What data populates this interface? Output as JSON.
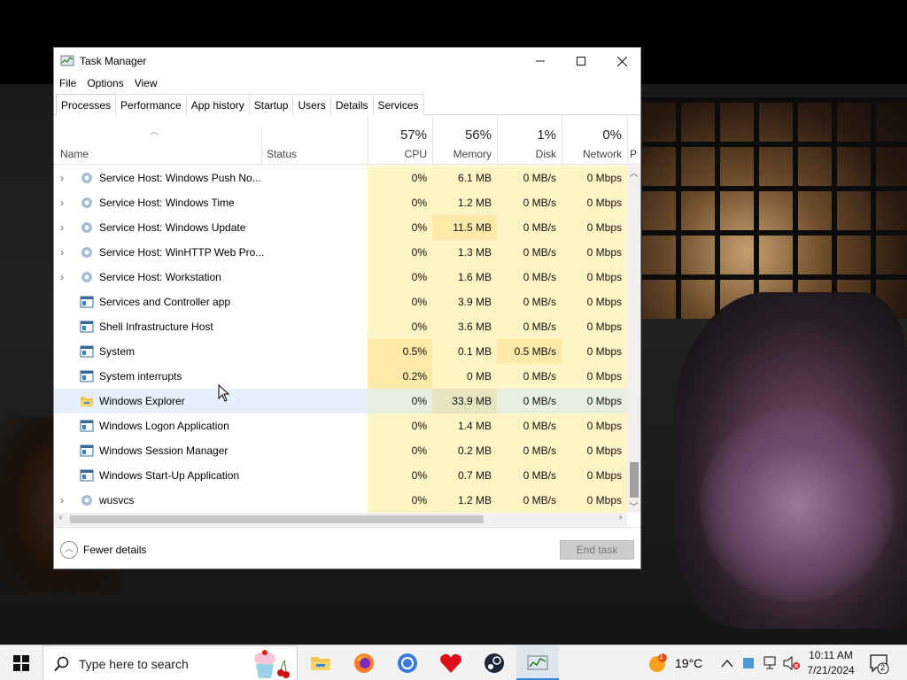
{
  "window": {
    "title": "Task Manager",
    "menu": [
      "File",
      "Options",
      "View"
    ],
    "tabs": [
      "Processes",
      "Performance",
      "App history",
      "Startup",
      "Users",
      "Details",
      "Services"
    ],
    "active_tab": "Processes"
  },
  "columns": {
    "name": "Name",
    "status": "Status",
    "cpu": {
      "pct": "57%",
      "label": "CPU"
    },
    "memory": {
      "pct": "56%",
      "label": "Memory"
    },
    "disk": {
      "pct": "1%",
      "label": "Disk"
    },
    "network": {
      "pct": "0%",
      "label": "Network"
    },
    "power_partial": "P"
  },
  "rows": [
    {
      "name": "Service Host: Windows Push No...",
      "cpu": "0%",
      "mem": "6.1 MB",
      "disk": "0 MB/s",
      "net": "0 Mbps",
      "expandable": true,
      "icon": "gear-icon"
    },
    {
      "name": "Service Host: Windows Time",
      "cpu": "0%",
      "mem": "1.2 MB",
      "disk": "0 MB/s",
      "net": "0 Mbps",
      "expandable": true,
      "icon": "gear-icon"
    },
    {
      "name": "Service Host: Windows Update",
      "cpu": "0%",
      "mem": "11.5 MB",
      "disk": "0 MB/s",
      "net": "0 Mbps",
      "expandable": true,
      "icon": "gear-icon"
    },
    {
      "name": "Service Host: WinHTTP Web Pro...",
      "cpu": "0%",
      "mem": "1.3 MB",
      "disk": "0 MB/s",
      "net": "0 Mbps",
      "expandable": true,
      "icon": "gear-icon"
    },
    {
      "name": "Service Host: Workstation",
      "cpu": "0%",
      "mem": "1.6 MB",
      "disk": "0 MB/s",
      "net": "0 Mbps",
      "expandable": true,
      "icon": "gear-icon"
    },
    {
      "name": "Services and Controller app",
      "cpu": "0%",
      "mem": "3.9 MB",
      "disk": "0 MB/s",
      "net": "0 Mbps",
      "expandable": false,
      "icon": "app-window-icon"
    },
    {
      "name": "Shell Infrastructure Host",
      "cpu": "0%",
      "mem": "3.6 MB",
      "disk": "0 MB/s",
      "net": "0 Mbps",
      "expandable": false,
      "icon": "app-window-icon"
    },
    {
      "name": "System",
      "cpu": "0.5%",
      "mem": "0.1 MB",
      "disk": "0.5 MB/s",
      "net": "0 Mbps",
      "expandable": false,
      "icon": "app-window-icon"
    },
    {
      "name": "System interrupts",
      "cpu": "0.2%",
      "mem": "0 MB",
      "disk": "0 MB/s",
      "net": "0 Mbps",
      "expandable": false,
      "icon": "app-window-icon"
    },
    {
      "name": "Windows Explorer",
      "cpu": "0%",
      "mem": "33.9 MB",
      "disk": "0 MB/s",
      "net": "0 Mbps",
      "expandable": false,
      "icon": "folder-icon"
    },
    {
      "name": "Windows Logon Application",
      "cpu": "0%",
      "mem": "1.4 MB",
      "disk": "0 MB/s",
      "net": "0 Mbps",
      "expandable": false,
      "icon": "app-window-icon"
    },
    {
      "name": "Windows Session Manager",
      "cpu": "0%",
      "mem": "0.2 MB",
      "disk": "0 MB/s",
      "net": "0 Mbps",
      "expandable": false,
      "icon": "app-window-icon"
    },
    {
      "name": "Windows Start-Up Application",
      "cpu": "0%",
      "mem": "0.7 MB",
      "disk": "0 MB/s",
      "net": "0 Mbps",
      "expandable": false,
      "icon": "app-window-icon"
    },
    {
      "name": "wusvcs",
      "cpu": "0%",
      "mem": "1.2 MB",
      "disk": "0 MB/s",
      "net": "0 Mbps",
      "expandable": true,
      "icon": "gear-icon"
    }
  ],
  "footer": {
    "fewer_details": "Fewer details",
    "end_task": "End task"
  },
  "taskbar": {
    "search_placeholder": "Type here to search",
    "weather_temp": "19°C",
    "weather_badge": "1",
    "time": "10:11 AM",
    "date": "7/21/2024",
    "notification_count": "2",
    "pinned_apps": [
      "file-explorer-icon",
      "firefox-icon",
      "chrome-icon",
      "heart-app-icon",
      "steam-icon",
      "task-manager-icon"
    ]
  },
  "colors": {
    "heat_light": "#fff4c4",
    "heat_medium": "#ffe9a8",
    "row_highlight": "#e6f0fa",
    "taskbar_accent": "#3a88d8"
  }
}
